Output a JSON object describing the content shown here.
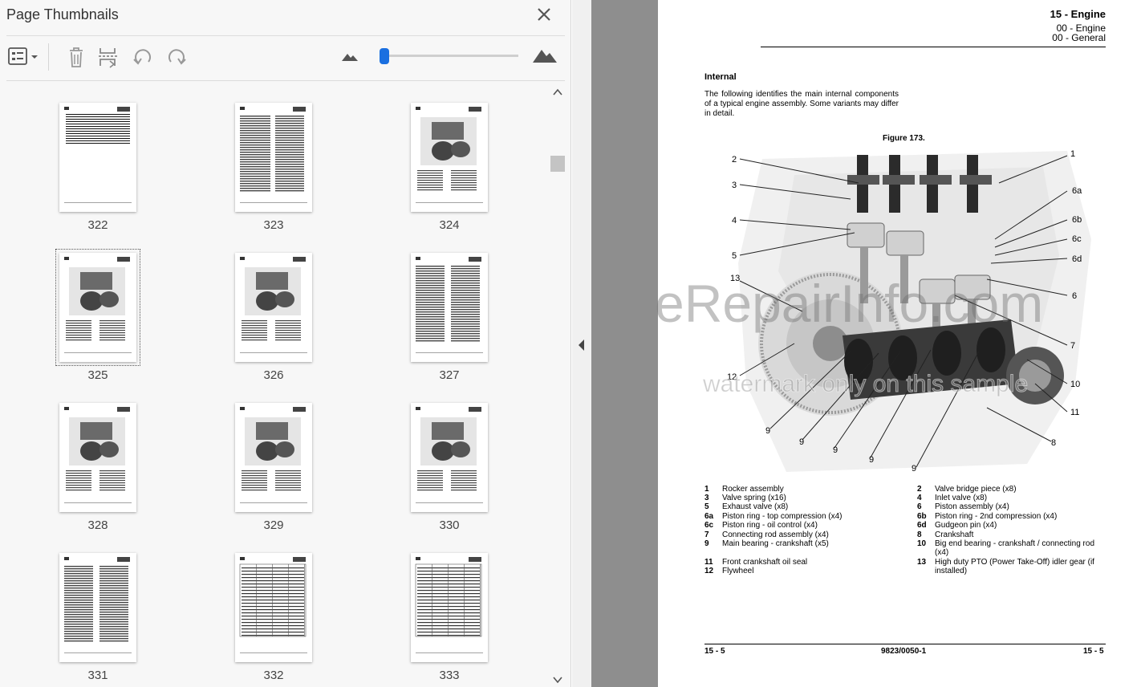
{
  "panel": {
    "title": "Page Thumbnails",
    "close_icon": "close-icon",
    "toolbar": {
      "options_icon": "thumbnail-options-icon",
      "delete_icon": "delete-icon",
      "extract_icon": "extract-pages-icon",
      "undo_icon": "rotate-counterclockwise-icon",
      "redo_icon": "rotate-clockwise-icon",
      "zoom_out_icon": "small-mountain-icon",
      "zoom_in_icon": "large-mountain-icon",
      "zoom_level": 0.0
    },
    "selected_page": "325",
    "thumbnails": [
      {
        "page": "322",
        "kind": "lines"
      },
      {
        "page": "323",
        "kind": "text2"
      },
      {
        "page": "324",
        "kind": "figure"
      },
      {
        "page": "325",
        "kind": "figure"
      },
      {
        "page": "326",
        "kind": "figure"
      },
      {
        "page": "327",
        "kind": "text1"
      },
      {
        "page": "328",
        "kind": "figure"
      },
      {
        "page": "329",
        "kind": "figure"
      },
      {
        "page": "330",
        "kind": "figure"
      },
      {
        "page": "331",
        "kind": "text1"
      },
      {
        "page": "332",
        "kind": "table"
      },
      {
        "page": "333",
        "kind": "table"
      }
    ]
  },
  "document": {
    "header": {
      "title": "15 - Engine",
      "sub1": "00 - Engine",
      "sub2": "00 - General"
    },
    "section_heading": "Internal",
    "intro": "The following identifies the main internal components of a typical engine assembly. Some variants may differ in detail.",
    "figure_caption": "Figure 173.",
    "callouts": [
      "1",
      "2",
      "3",
      "4",
      "5",
      "6a",
      "6b",
      "6c",
      "6d",
      "6",
      "7",
      "8",
      "9",
      "9",
      "9",
      "9",
      "9",
      "10",
      "11",
      "12",
      "13"
    ],
    "watermark_main": "eRepairInfo.com",
    "watermark_sub": "watermark only on this sample",
    "legend": [
      {
        "k": "1",
        "v": "Rocker assembly"
      },
      {
        "k": "2",
        "v": "Valve bridge piece (x8)"
      },
      {
        "k": "3",
        "v": "Valve spring (x16)"
      },
      {
        "k": "4",
        "v": "Inlet valve (x8)"
      },
      {
        "k": "5",
        "v": "Exhaust valve (x8)"
      },
      {
        "k": "6",
        "v": "Piston assembly (x4)"
      },
      {
        "k": "6a",
        "v": "Piston ring - top compression (x4)"
      },
      {
        "k": "6b",
        "v": "Piston ring - 2nd compression (x4)"
      },
      {
        "k": "6c",
        "v": "Piston ring - oil control (x4)"
      },
      {
        "k": "6d",
        "v": "Gudgeon pin (x4)"
      },
      {
        "k": "7",
        "v": "Connecting rod assembly (x4)"
      },
      {
        "k": "8",
        "v": "Crankshaft"
      },
      {
        "k": "9",
        "v": "Main bearing - crankshaft (x5)"
      },
      {
        "k": "10",
        "v": "Big end bearing - crankshaft / connecting rod (x4)"
      },
      {
        "k": "11",
        "v": "Front crankshaft oil seal"
      },
      {
        "k": "12",
        "v": "Flywheel"
      },
      {
        "k": "13",
        "v": "High duty PTO (Power Take-Off) idler gear (if installed)"
      }
    ],
    "footer": {
      "left": "15 - 5",
      "center": "9823/0050-1",
      "right": "15 - 5"
    }
  }
}
